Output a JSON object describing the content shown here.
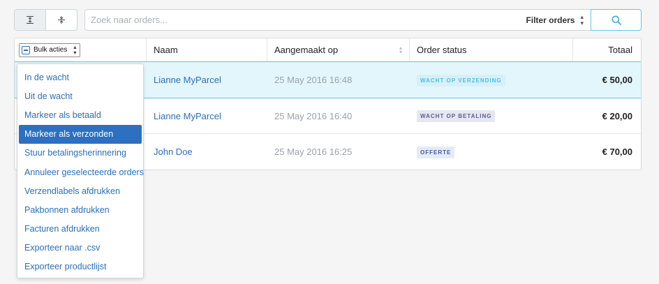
{
  "toolbar": {
    "search_placeholder": "Zoek naar orders...",
    "filter_label": "Filter orders",
    "filter_arrows": "⇕"
  },
  "table": {
    "bulk_label": "Bulk acties",
    "headers": {
      "name": "Naam",
      "created": "Aangemaakt op",
      "status": "Order status",
      "total": "Totaal"
    },
    "rows": [
      {
        "name": "Lianne MyParcel",
        "date": "25 May 2016 16:48",
        "status": "WACHT OP VERZENDING",
        "total": "€ 50,00",
        "status_color": "#4fbde0",
        "status_bg": "#d5f0f9"
      },
      {
        "name": "Lianne MyParcel",
        "date": "25 May 2016 16:40",
        "status": "WACHT OP BETALING",
        "total": "€ 20,00",
        "status_color": "#5a5e8c",
        "status_bg": "#e6e7f2"
      },
      {
        "name": "John Doe",
        "date": "25 May 2016 16:25",
        "status": "OFFERTE",
        "total": "€ 70,00",
        "status_color": "#3d5a99",
        "status_bg": "#e5eaf5"
      }
    ]
  },
  "bulk_menu": {
    "items": [
      "In de wacht",
      "Uit de wacht",
      "Markeer als betaald",
      "Markeer als verzonden",
      "Stuur betalingsherinnering",
      "Annuleer geselecteerde orders",
      "Verzendlabels afdrukken",
      "Pakbonnen afdrukken",
      "Facturen afdrukken",
      "Exporteer naar .csv",
      "Exporteer productlijst"
    ],
    "highlighted_index": 3
  },
  "colors": {
    "accent": "#5fc8e8",
    "link": "#2b6fb8",
    "highlight": "#2d6fc0"
  }
}
